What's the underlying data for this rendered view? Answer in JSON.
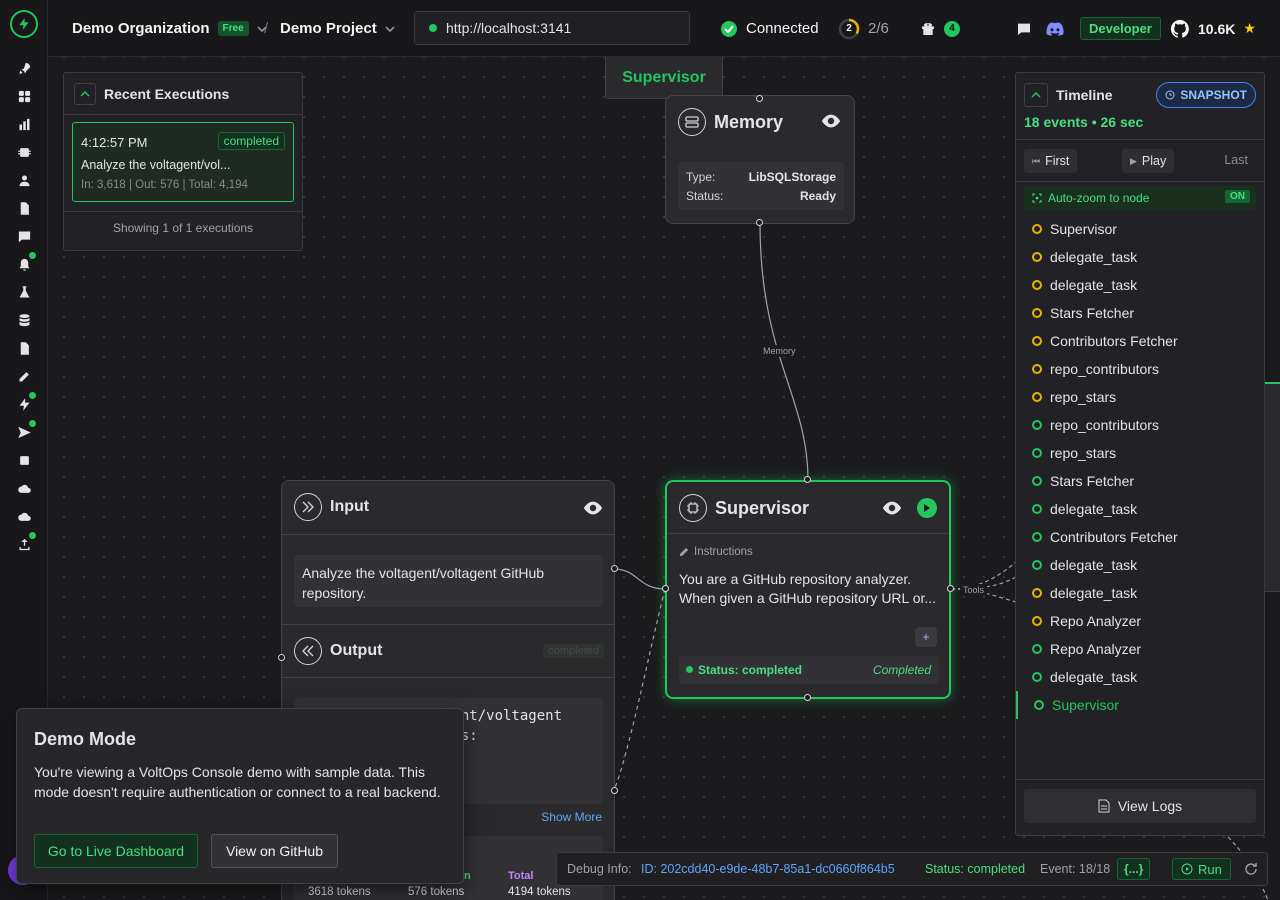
{
  "header": {
    "org_name": "Demo Organization",
    "org_plan": "Free",
    "separator": "/",
    "project_name": "Demo Project",
    "server_url": "http://localhost:3141",
    "connection_status": "Connected",
    "progress_number": "2",
    "progress_label": "2/6",
    "progress_fraction": 0.3333,
    "gift_count": "4",
    "role_badge": "Developer",
    "github_stars": "10.6K",
    "star_glyph": "★"
  },
  "recent_executions": {
    "title": "Recent Executions",
    "item": {
      "time": "4:12:57 PM",
      "status": "completed",
      "summary": "Analyze the voltagent/vol...",
      "tokens": "In: 3,618 | Out: 576 | Total: 4,194"
    },
    "footer": "Showing 1 of 1 executions"
  },
  "supervisor_label": "Supervisor",
  "memory_node": {
    "title": "Memory",
    "type_label": "Type:",
    "type_value": "LibSQLStorage",
    "status_label": "Status:",
    "status_value": "Ready",
    "edge_label": "Memory"
  },
  "input_node": {
    "title": "Input",
    "text": "Analyze the voltagent/voltagent GitHub repository.",
    "output_title": "Output",
    "output_badge": "completed",
    "output_text_1": "gent/voltagent",
    "output_text_2": "ows:",
    "show_more": "Show More",
    "total_label": "Total",
    "in_partial": "n",
    "in_tokens": "3618 tokens",
    "out_tokens": "576 tokens",
    "total_tokens": "4194 tokens"
  },
  "supervisor_node": {
    "title": "Supervisor",
    "instructions_label": "Instructions",
    "instructions_text": "You are a GitHub repository analyzer. When given a GitHub repository URL or...",
    "status_text": "Status: completed",
    "status_right": "Completed",
    "tools_label": "Tools",
    "plus": "+"
  },
  "timeline": {
    "title": "Timeline",
    "snapshot_badge": "SNAPSHOT",
    "summary": "18 events • 26 sec",
    "first_btn": "First",
    "play_btn": "Play",
    "last_btn": "Last",
    "autozoom_label": "Auto-zoom to node",
    "autozoom_state": "ON",
    "events": [
      {
        "label": "Supervisor",
        "color": "#eab308",
        "active": false
      },
      {
        "label": "delegate_task",
        "color": "#eab308",
        "active": false
      },
      {
        "label": "delegate_task",
        "color": "#eab308",
        "active": false
      },
      {
        "label": "Stars Fetcher",
        "color": "#eab308",
        "active": false
      },
      {
        "label": "Contributors Fetcher",
        "color": "#eab308",
        "active": false
      },
      {
        "label": "repo_contributors",
        "color": "#eab308",
        "active": false
      },
      {
        "label": "repo_stars",
        "color": "#eab308",
        "active": false
      },
      {
        "label": "repo_contributors",
        "color": "#22c55e",
        "active": false
      },
      {
        "label": "repo_stars",
        "color": "#22c55e",
        "active": false
      },
      {
        "label": "Stars Fetcher",
        "color": "#22c55e",
        "active": false
      },
      {
        "label": "delegate_task",
        "color": "#22c55e",
        "active": false
      },
      {
        "label": "Contributors Fetcher",
        "color": "#22c55e",
        "active": false
      },
      {
        "label": "delegate_task",
        "color": "#22c55e",
        "active": false
      },
      {
        "label": "delegate_task",
        "color": "#eab308",
        "active": false
      },
      {
        "label": "Repo Analyzer",
        "color": "#eab308",
        "active": false
      },
      {
        "label": "Repo Analyzer",
        "color": "#22c55e",
        "active": false
      },
      {
        "label": "delegate_task",
        "color": "#22c55e",
        "active": false
      },
      {
        "label": "Supervisor",
        "color": "#22c55e",
        "active": true
      }
    ],
    "view_logs": "View Logs"
  },
  "demo_mode": {
    "title": "Demo Mode",
    "body": "You're viewing a VoltOps Console demo with sample data. This mode doesn't require authentication or connect to a real backend.",
    "live_button": "Go to Live Dashboard",
    "github_button": "View on GitHub"
  },
  "debug_bar": {
    "label": "Debug Info:",
    "id": "ID: 202cdd40-e9de-48b7-85a1-dc0660f864b5",
    "status": "Status: completed",
    "event": "Event: 18/18",
    "json_btn": "{...}",
    "run_btn": "Run"
  },
  "colors": {
    "accent": "#22c55e",
    "warning": "#eab308",
    "link": "#60a5fa"
  }
}
